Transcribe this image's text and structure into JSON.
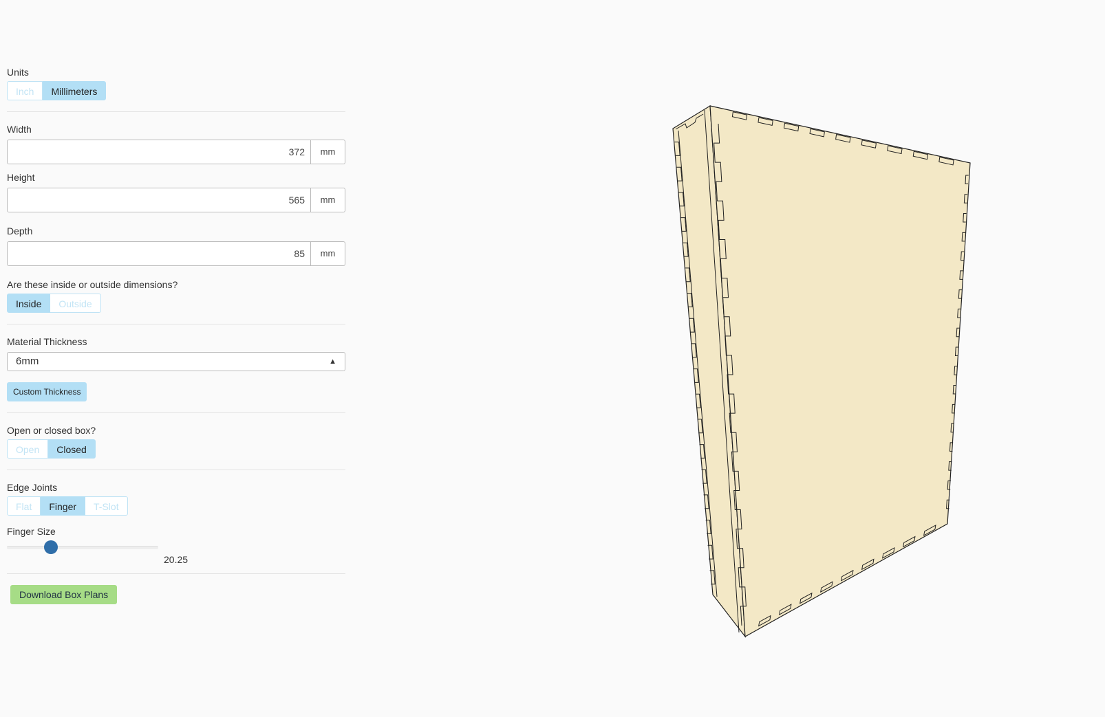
{
  "units": {
    "label": "Units",
    "options": [
      "Inch",
      "Millimeters"
    ],
    "selected": "Millimeters"
  },
  "dimensions": {
    "width": {
      "label": "Width",
      "value": "372",
      "unit": "mm"
    },
    "height": {
      "label": "Height",
      "value": "565",
      "unit": "mm"
    },
    "depth": {
      "label": "Depth",
      "value": "85",
      "unit": "mm"
    }
  },
  "inside_outside": {
    "label": "Are these inside or outside dimensions?",
    "options": [
      "Inside",
      "Outside"
    ],
    "selected": "Inside"
  },
  "material": {
    "label": "Material Thickness",
    "selected": "6mm",
    "custom_button": "Custom Thickness"
  },
  "open_closed": {
    "label": "Open or closed box?",
    "options": [
      "Open",
      "Closed"
    ],
    "selected": "Closed"
  },
  "edge_joints": {
    "label": "Edge Joints",
    "options": [
      "Flat",
      "Finger",
      "T-Slot"
    ],
    "selected": "Finger"
  },
  "finger_size": {
    "label": "Finger Size",
    "value": "20.25",
    "slider_fraction": 0.27
  },
  "download_button": "Download Box Plans",
  "colors": {
    "accent": "#b3dff5",
    "thumb": "#2f6ea9",
    "download": "#a6dc86",
    "box_face": "#f3e8c6"
  }
}
